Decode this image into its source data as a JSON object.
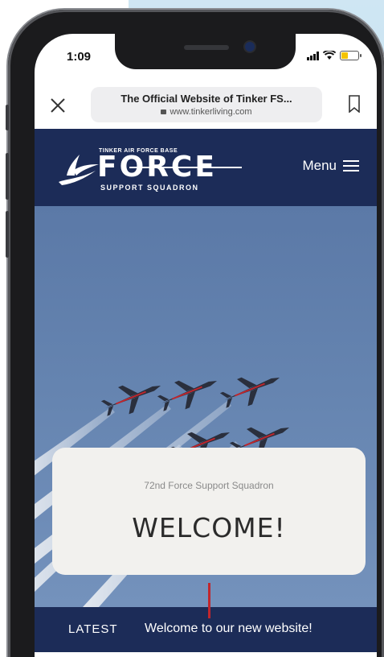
{
  "status_bar": {
    "time": "1:09",
    "battery_level": 0.4,
    "battery_color": "#f5c400"
  },
  "browser": {
    "page_title": "The Official Website of Tinker FS...",
    "domain": "www.tinkerliving.com",
    "close_icon": "close-icon",
    "bookmark_icon": "bookmark-icon"
  },
  "header": {
    "logo": {
      "top_text": "TINKER AIR FORCE BASE",
      "word": "FORCE",
      "sub_text": "SUPPORT SQUADRON"
    },
    "menu_label": "Menu",
    "brand_color": "#1c2c58"
  },
  "hero": {
    "card_subtitle": "72nd Force Support Squadron",
    "card_title": "WELCOME!"
  },
  "ticker": {
    "label": "LATEST",
    "headline": "Welcome to our new website!",
    "marker_color": "#c0262d"
  }
}
